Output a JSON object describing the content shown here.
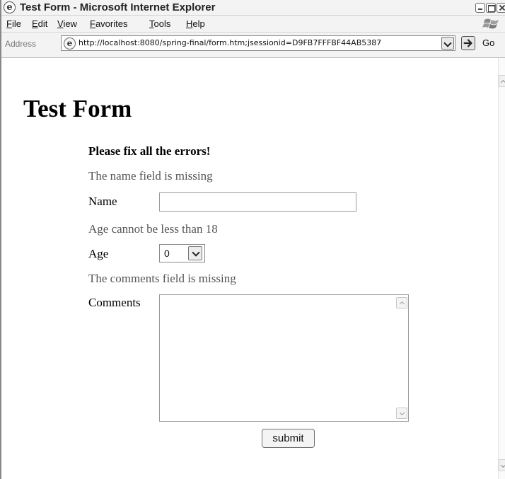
{
  "window": {
    "title": "Test Form - Microsoft Internet Explorer"
  },
  "menu": {
    "file": "File",
    "edit": "Edit",
    "view": "View",
    "favorites": "Favorites",
    "tools": "Tools",
    "help": "Help"
  },
  "address_bar": {
    "label": "Address",
    "url": "http://localhost:8080/spring-final/form.htm;jsessionid=D9FB7FFFBF44AB5387",
    "go_label": "Go"
  },
  "page": {
    "title": "Test Form",
    "error_summary": "Please fix all the errors!",
    "fields": {
      "name": {
        "error": "The name field is missing",
        "label": "Name",
        "value": ""
      },
      "age": {
        "error": "Age cannot be less than 18",
        "label": "Age",
        "value": "0"
      },
      "comments": {
        "error": "The comments field is missing",
        "label": "Comments",
        "value": ""
      }
    },
    "submit_label": "submit"
  }
}
